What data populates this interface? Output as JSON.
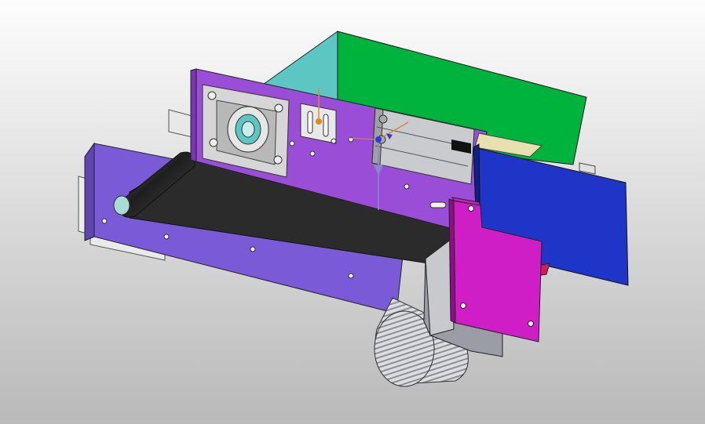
{
  "viewport": {
    "background_top": "#fdfdfd",
    "background_bottom": "#b9b9b9"
  },
  "model": {
    "parts": [
      {
        "name": "hopper-back-panel",
        "color": "#00b33c"
      },
      {
        "name": "hopper-side-panel",
        "color": "#5cc6c2"
      },
      {
        "name": "frame-side-plate-upper",
        "color": "#9a4ed8"
      },
      {
        "name": "frame-side-plate-lower",
        "color": "#7a5ad6"
      },
      {
        "name": "conveyor-belt",
        "color": "#2b2b2b"
      },
      {
        "name": "drive-bracket",
        "color": "#d01ec7"
      },
      {
        "name": "guide-plate",
        "color": "#1f35c8"
      },
      {
        "name": "motor-gearbox",
        "color": "#9a9ca6"
      },
      {
        "name": "motor-body",
        "color": "#c7c9cd"
      },
      {
        "name": "linear-actuator",
        "color": "#c9cbce"
      },
      {
        "name": "bearing-housing",
        "color": "#d6d6d6"
      }
    ],
    "triad": {
      "x_color": "#d98a3a",
      "y_color": "#8888c8",
      "z_color": "#d98a3a"
    }
  }
}
